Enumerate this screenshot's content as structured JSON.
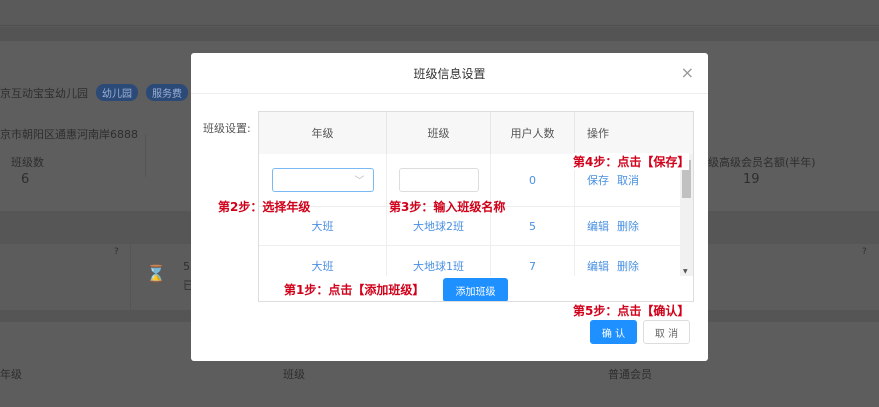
{
  "background": {
    "school_name": "京互动宝宝幼儿园",
    "tags": [
      "幼儿园",
      "服务费"
    ],
    "address": "京市朝阳区通惠河南岸6888",
    "stats": [
      {
        "label": "班级数",
        "value": "6"
      },
      {
        "label": "级高级会员名额(半年)",
        "value": "19"
      }
    ],
    "card_text": "5",
    "card_sub": "已",
    "table_headers": [
      "年级",
      "班级",
      "普通会员"
    ]
  },
  "modal": {
    "title": "班级信息设置",
    "close": "×",
    "field_label": "班级设置:",
    "headers": [
      "年级",
      "班级",
      "用户人数",
      "操作"
    ],
    "new_row": {
      "grade_placeholder": "",
      "class_value": "",
      "users": "0",
      "actions": [
        "保存",
        "取消"
      ]
    },
    "rows": [
      {
        "grade": "大班",
        "class": "大地球2班",
        "users": "5",
        "actions": [
          "编辑",
          "删除"
        ]
      },
      {
        "grade": "大班",
        "class": "大地球1班",
        "users": "7",
        "actions": [
          "编辑",
          "删除"
        ]
      }
    ],
    "add_button": "添加班级",
    "confirm": "确 认",
    "cancel": "取 消"
  },
  "steps": {
    "s1": "第1步：点击【添加班级】",
    "s2": "第2步：选择年级",
    "s3": "第3步：输入班级名称",
    "s4": "第4步：点击【保存】",
    "s5": "第5步：点击【确认】"
  }
}
